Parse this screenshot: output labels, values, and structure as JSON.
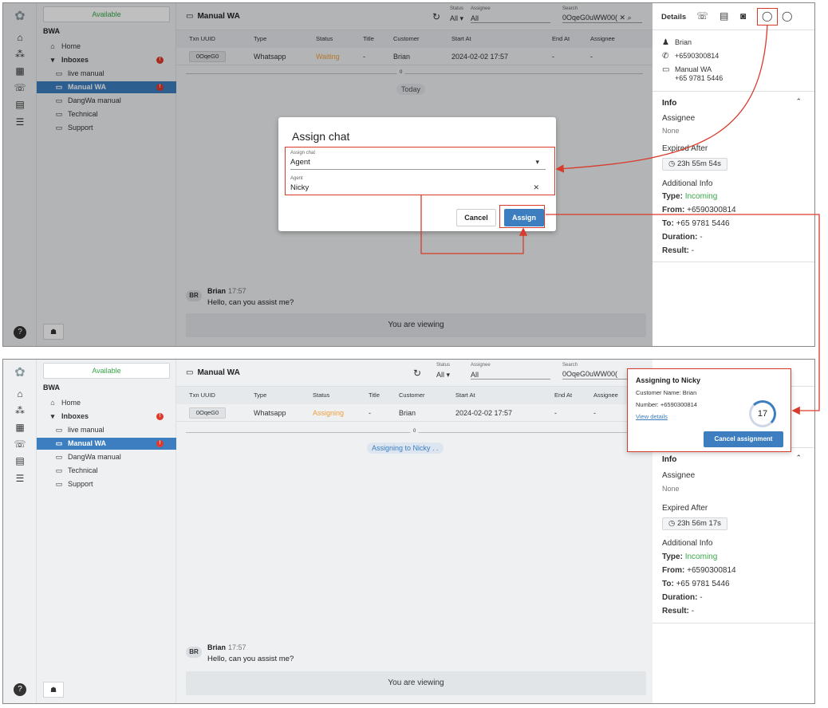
{
  "colors": {
    "accent": "#3c7ec0",
    "available": "#39a84a",
    "waiting": "#f0a03a",
    "annotation": "#d93a2b",
    "badge": "#e03a2e"
  },
  "sidebar": {
    "status": "Available",
    "org": "BWA",
    "home": "Home",
    "inboxes": "Inboxes",
    "items": [
      "live manual",
      "Manual WA",
      "DangWa manual",
      "Technical",
      "Support"
    ],
    "selected": "Manual WA"
  },
  "rail_icons": [
    "logo-icon",
    "home-icon",
    "team-icon",
    "dashboard-icon",
    "call-log-icon",
    "contacts-icon",
    "list-icon",
    "help-icon",
    "group-icon"
  ],
  "topbar": {
    "title": "Manual WA",
    "status_label": "Status",
    "status_value": "All",
    "assignee_label": "Assignee",
    "assignee_value": "All",
    "search_label": "Search",
    "search_value_1": "0OqeG0uWW00(",
    "search_value_2": "0OqeG0uWW00("
  },
  "table": {
    "columns": [
      "Txn UUID",
      "Type",
      "Status",
      "Title",
      "Customer",
      "Start At",
      "End At",
      "Assignee"
    ],
    "row_1": {
      "uuid": "0OqeG0",
      "type": "Whatsapp",
      "status": "Waiting",
      "title": "-",
      "customer": "Brian",
      "start": "2024-02-02 17:57",
      "end": "-",
      "assignee": "-"
    },
    "row_2": {
      "uuid": "0OqeG0",
      "type": "Whatsapp",
      "status": "Assigning",
      "title": "-",
      "customer": "Brian",
      "start": "2024-02-02 17:57",
      "end": "-",
      "assignee": "-"
    }
  },
  "conversation": {
    "divider_count": "0",
    "today": "Today",
    "assigning_pill": "Assigning to Nicky . .",
    "sender_initials": "BR",
    "sender": "Brian",
    "time": "17:57",
    "message": "Hello, can you assist me?",
    "viewing": "You are viewing"
  },
  "details": {
    "title": "Details",
    "name": "Brian",
    "phone": "+6590300814",
    "channel": "Manual WA",
    "channel_number": "+65 9781 5446"
  },
  "info": {
    "title": "Info",
    "assignee_label": "Assignee",
    "assignee_value": "None",
    "expired_label": "Expired After",
    "expired_value_1": "23h 55m 54s",
    "expired_value_2": "23h 56m 17s",
    "additional": "Additional Info",
    "type_k": "Type:",
    "type_v": "Incoming",
    "from_k": "From:",
    "from_v": "+6590300814",
    "to_k": "To:",
    "to_v": "+65 9781 5446",
    "duration_k": "Duration:",
    "duration_v": "-",
    "result_k": "Result:",
    "result_v": "-"
  },
  "modal": {
    "title": "Assign chat",
    "field1_label": "Assign chat",
    "field1_value": "Agent",
    "field2_label": "Agent",
    "field2_value": "Nicky",
    "cancel": "Cancel",
    "assign": "Assign"
  },
  "popup": {
    "title": "Assigning to Nicky",
    "customer": "Customer Name: Brian",
    "number": "Number: +6590300814",
    "link": "View details",
    "countdown": "17",
    "cancel": "Cancel assignment"
  }
}
